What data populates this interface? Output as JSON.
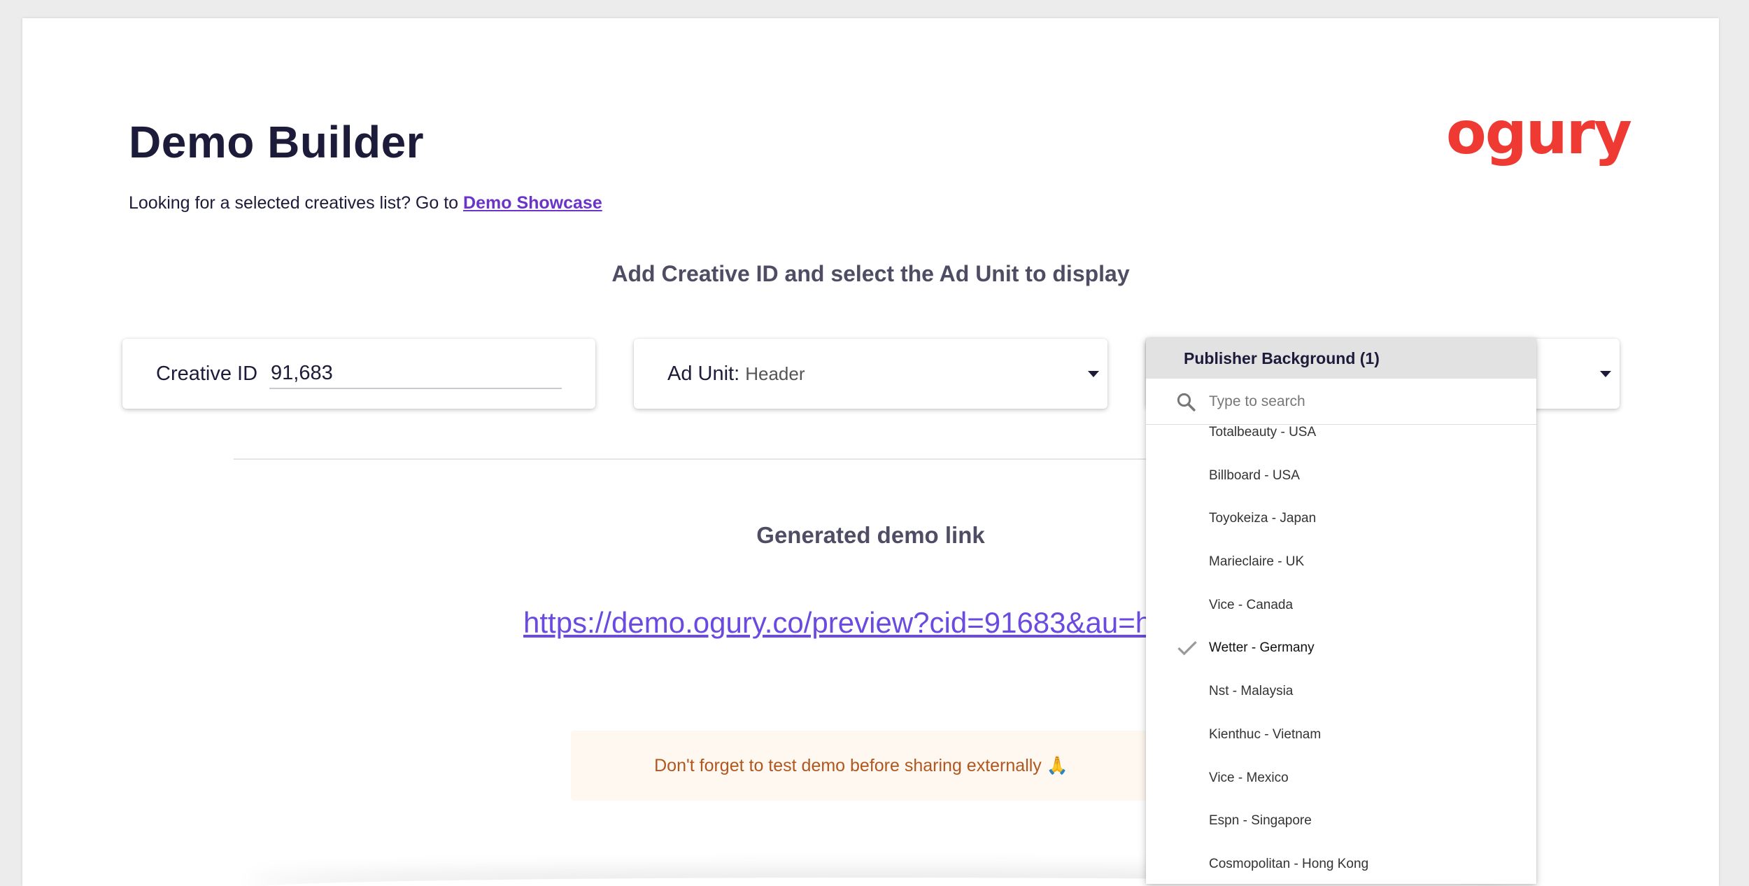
{
  "header": {
    "title": "Demo Builder",
    "subtitle_prefix": "Looking for a selected creatives list? Go to",
    "subtitle_link": "Demo Showcase",
    "logo_text": "ogury"
  },
  "form": {
    "heading": "Add Creative ID and select the Ad Unit to display",
    "creative_label": "Creative ID",
    "creative_value": "91,683",
    "adunit_label": "Ad Unit",
    "adunit_separator": ":",
    "adunit_value": "Header"
  },
  "dropdown": {
    "header": "Publisher Background (1)",
    "search_placeholder": "Type to search",
    "items": [
      {
        "label": "Totalbeauty - USA",
        "selected": false
      },
      {
        "label": "Billboard - USA",
        "selected": false
      },
      {
        "label": "Toyokeiza - Japan",
        "selected": false
      },
      {
        "label": "Marieclaire - UK",
        "selected": false
      },
      {
        "label": "Vice - Canada",
        "selected": false
      },
      {
        "label": "Wetter - Germany",
        "selected": true
      },
      {
        "label": "Nst - Malaysia",
        "selected": false
      },
      {
        "label": "Kienthuc - Vietnam",
        "selected": false
      },
      {
        "label": "Vice - Mexico",
        "selected": false
      },
      {
        "label": "Espn - Singapore",
        "selected": false
      },
      {
        "label": "Cosmopolitan - Hong Kong",
        "selected": false
      }
    ]
  },
  "result": {
    "heading": "Generated demo link",
    "link_text": "https://demo.ogury.co/preview?cid=91683&au=h",
    "notice": "Don't forget to test demo before sharing externally 🙏"
  },
  "colors": {
    "brand": "#ee3a32",
    "link": "#6a4ae0",
    "showcase_link": "#6a34c9",
    "title": "#1d1b3a",
    "notice_text": "#b0571f",
    "notice_bg": "#fff8f1"
  },
  "icons": {
    "search": "search-icon",
    "check": "check-icon",
    "caret": "caret-down-icon"
  }
}
